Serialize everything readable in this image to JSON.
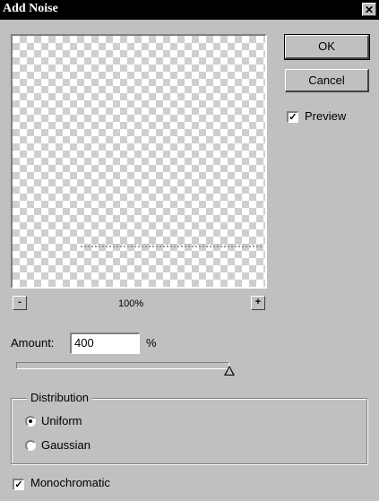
{
  "window": {
    "title": "Add Noise",
    "close_glyph": "✕"
  },
  "buttons": {
    "ok_label": "OK",
    "cancel_label": "Cancel"
  },
  "preview": {
    "checked": true,
    "label": "Preview",
    "check_glyph": "✓"
  },
  "zoom": {
    "minus_label": "-",
    "plus_label": "+",
    "level": "100%"
  },
  "amount": {
    "label": "Amount:",
    "value": "400",
    "unit": "%",
    "slider_fraction": 1.0
  },
  "distribution": {
    "legend": "Distribution",
    "options": [
      {
        "label": "Uniform",
        "selected": true
      },
      {
        "label": "Gaussian",
        "selected": false
      }
    ]
  },
  "monochromatic": {
    "label": "Monochromatic",
    "checked": true,
    "check_glyph": "✓"
  }
}
